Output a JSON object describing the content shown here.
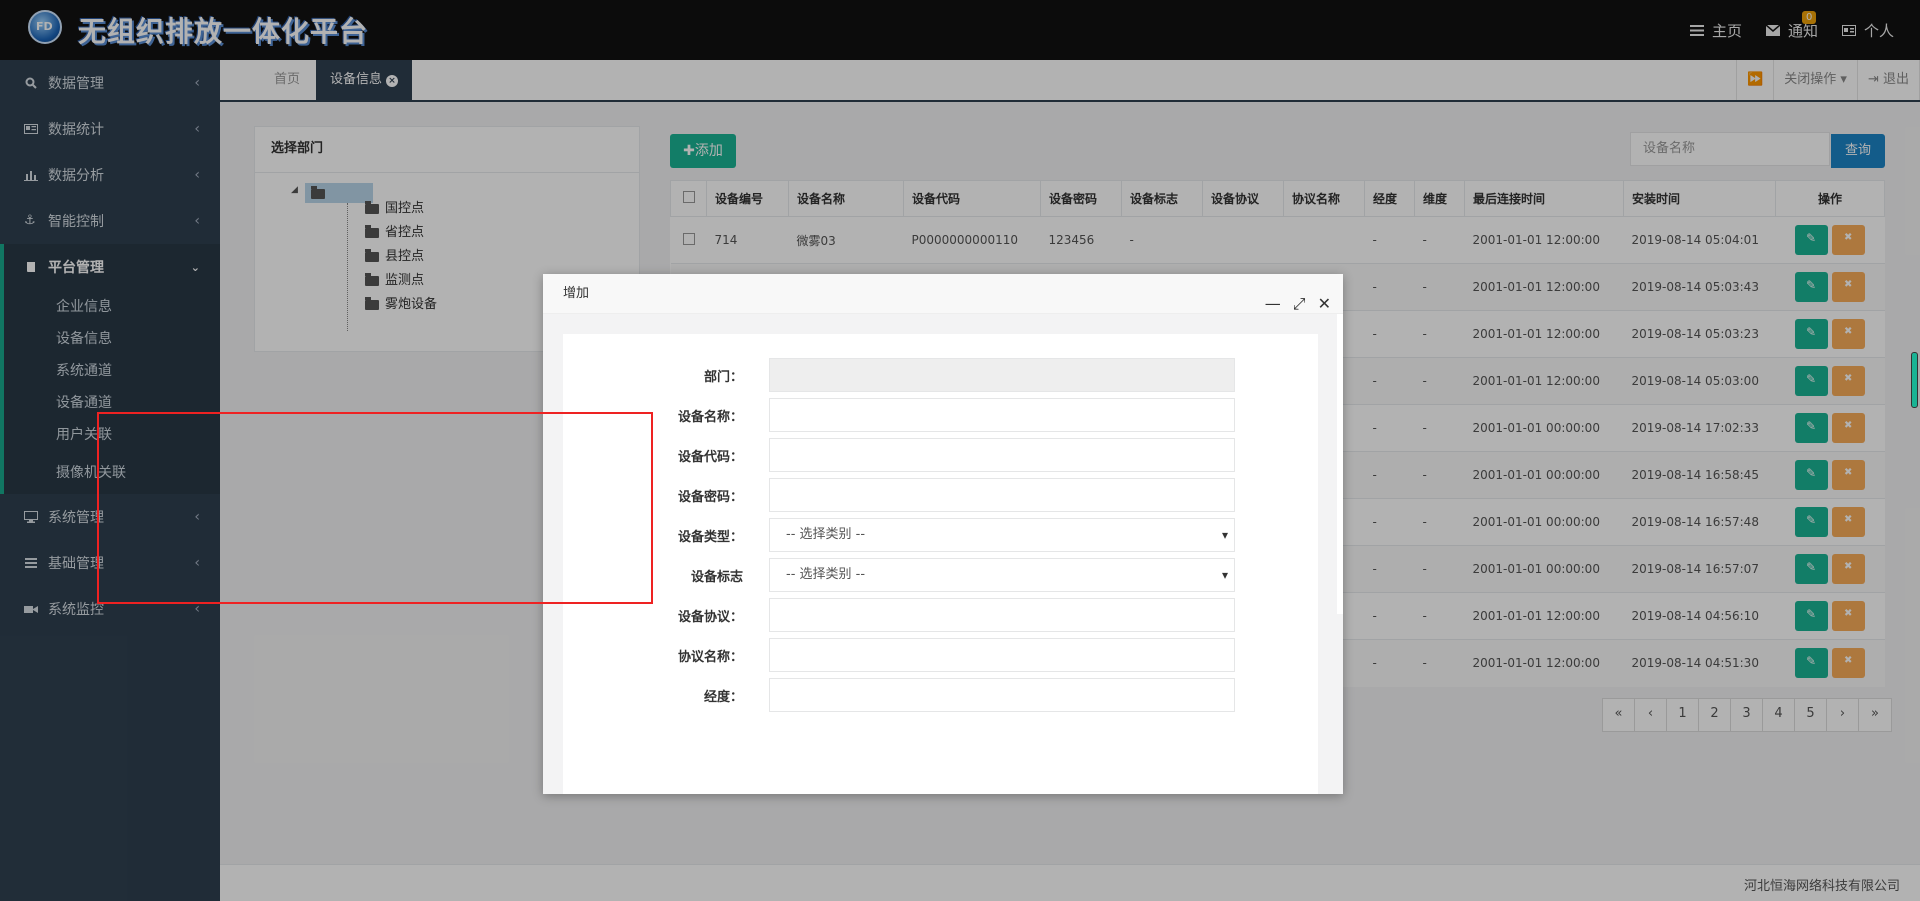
{
  "header": {
    "logo_text": "FD",
    "app_title": "无组织排放一体化平台",
    "nav": [
      {
        "label": "主页",
        "icon": "home-icon"
      },
      {
        "label": "通知",
        "icon": "mail-icon",
        "badge": "0"
      },
      {
        "label": "个人",
        "icon": "id-card-icon"
      }
    ]
  },
  "sidebar": {
    "items_top": [
      {
        "label": "数据管理",
        "icon": "search-icon"
      },
      {
        "label": "数据统计",
        "icon": "newspaper-icon"
      },
      {
        "label": "数据分析",
        "icon": "bar-chart-icon"
      },
      {
        "label": "智能控制",
        "icon": "anchor-icon"
      }
    ],
    "group": {
      "label": "平台管理",
      "icon": "book-icon",
      "subitems": [
        "企业信息",
        "设备信息",
        "系统通道",
        "设备通道",
        "用户关联",
        "摄像机关联"
      ]
    },
    "items_bottom": [
      {
        "label": "系统管理",
        "icon": "desktop-icon"
      },
      {
        "label": "基础管理",
        "icon": "bars-icon"
      },
      {
        "label": "系统监控",
        "icon": "video-icon"
      }
    ]
  },
  "tabs": {
    "home": "首页",
    "active": "设备信息",
    "close_ops": "关闭操作",
    "logout": "退出"
  },
  "dept": {
    "title": "选择部门",
    "nodes": [
      "国控点",
      "省控点",
      "县控点",
      "监测点",
      "雾炮设备"
    ]
  },
  "toolbar": {
    "add_label": "添加",
    "search_placeholder": "设备名称",
    "search_label": "查询"
  },
  "table": {
    "headers": [
      "设备编号",
      "设备名称",
      "设备代码",
      "设备密码",
      "设备标志",
      "设备协议",
      "协议名称",
      "经度",
      "维度",
      "最后连接时间",
      "安装时间",
      "操作"
    ],
    "first_row": {
      "id": "714",
      "name": "微雾03",
      "code": "P0000000000110",
      "password": "123456",
      "flag": "-"
    },
    "rows": [
      {
        "lng": "-",
        "lat": "-",
        "last": "2001-01-01 12:00:00",
        "install": "2019-08-14 05:04:01"
      },
      {
        "lng": "-",
        "lat": "-",
        "last": "2001-01-01 12:00:00",
        "install": "2019-08-14 05:03:43"
      },
      {
        "lng": "-",
        "lat": "-",
        "last": "2001-01-01 12:00:00",
        "install": "2019-08-14 05:03:23"
      },
      {
        "lng": "-",
        "lat": "-",
        "last": "2001-01-01 12:00:00",
        "install": "2019-08-14 05:03:00"
      },
      {
        "lng": "-",
        "lat": "-",
        "last": "2001-01-01 00:00:00",
        "install": "2019-08-14 17:02:33"
      },
      {
        "lng": "-",
        "lat": "-",
        "last": "2001-01-01 00:00:00",
        "install": "2019-08-14 16:58:45"
      },
      {
        "lng": "-",
        "lat": "-",
        "last": "2001-01-01 00:00:00",
        "install": "2019-08-14 16:57:48"
      },
      {
        "lng": "-",
        "lat": "-",
        "last": "2001-01-01 00:00:00",
        "install": "2019-08-14 16:57:07"
      },
      {
        "lng": "-",
        "lat": "-",
        "last": "2001-01-01 12:00:00",
        "install": "2019-08-14 04:56:10"
      },
      {
        "lng": "-",
        "lat": "-",
        "last": "2001-01-01 12:00:00",
        "install": "2019-08-14 04:51:30"
      }
    ]
  },
  "pager": [
    "«",
    "‹",
    "1",
    "2",
    "3",
    "4",
    "5",
    "›",
    "»"
  ],
  "footer": {
    "company": "河北恒海网络科技有限公司"
  },
  "modal": {
    "title": "增加",
    "fields": [
      {
        "label": "部门：",
        "value": ""
      },
      {
        "label": "设备名称：",
        "value": ""
      },
      {
        "label": "设备代码：",
        "value": ""
      },
      {
        "label": "设备密码：",
        "value": ""
      },
      {
        "label": "设备类型：",
        "value": "-- 选择类别 --"
      },
      {
        "label": "设备标志",
        "value": "-- 选择类别 --"
      },
      {
        "label": "设备协议：",
        "value": ""
      },
      {
        "label": "协议名称：",
        "value": ""
      },
      {
        "label": "经度：",
        "value": ""
      }
    ]
  },
  "colors": {
    "topbar": "#121212",
    "sidebar": "#2f4050",
    "primary": "#1ab394",
    "warning": "#f8ac59",
    "blue": "#1c84c6",
    "highlight_box": "#ee2222"
  }
}
